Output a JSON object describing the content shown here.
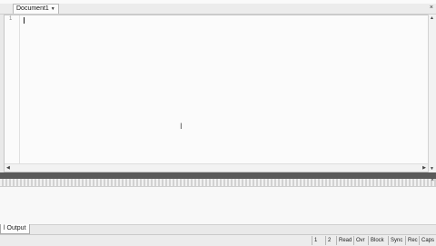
{
  "document_tab": {
    "label": "Document1",
    "dropdown_icon": "chevron-down-icon"
  },
  "editor": {
    "line_number": "1"
  },
  "output_panel": {
    "tab_label": "l Output"
  },
  "status_bar": {
    "line": "1",
    "column": "2",
    "read": "Read",
    "ovr": "Ovr",
    "block": "Block",
    "sync": "Sync",
    "rec": "Rec",
    "caps": "Caps"
  }
}
